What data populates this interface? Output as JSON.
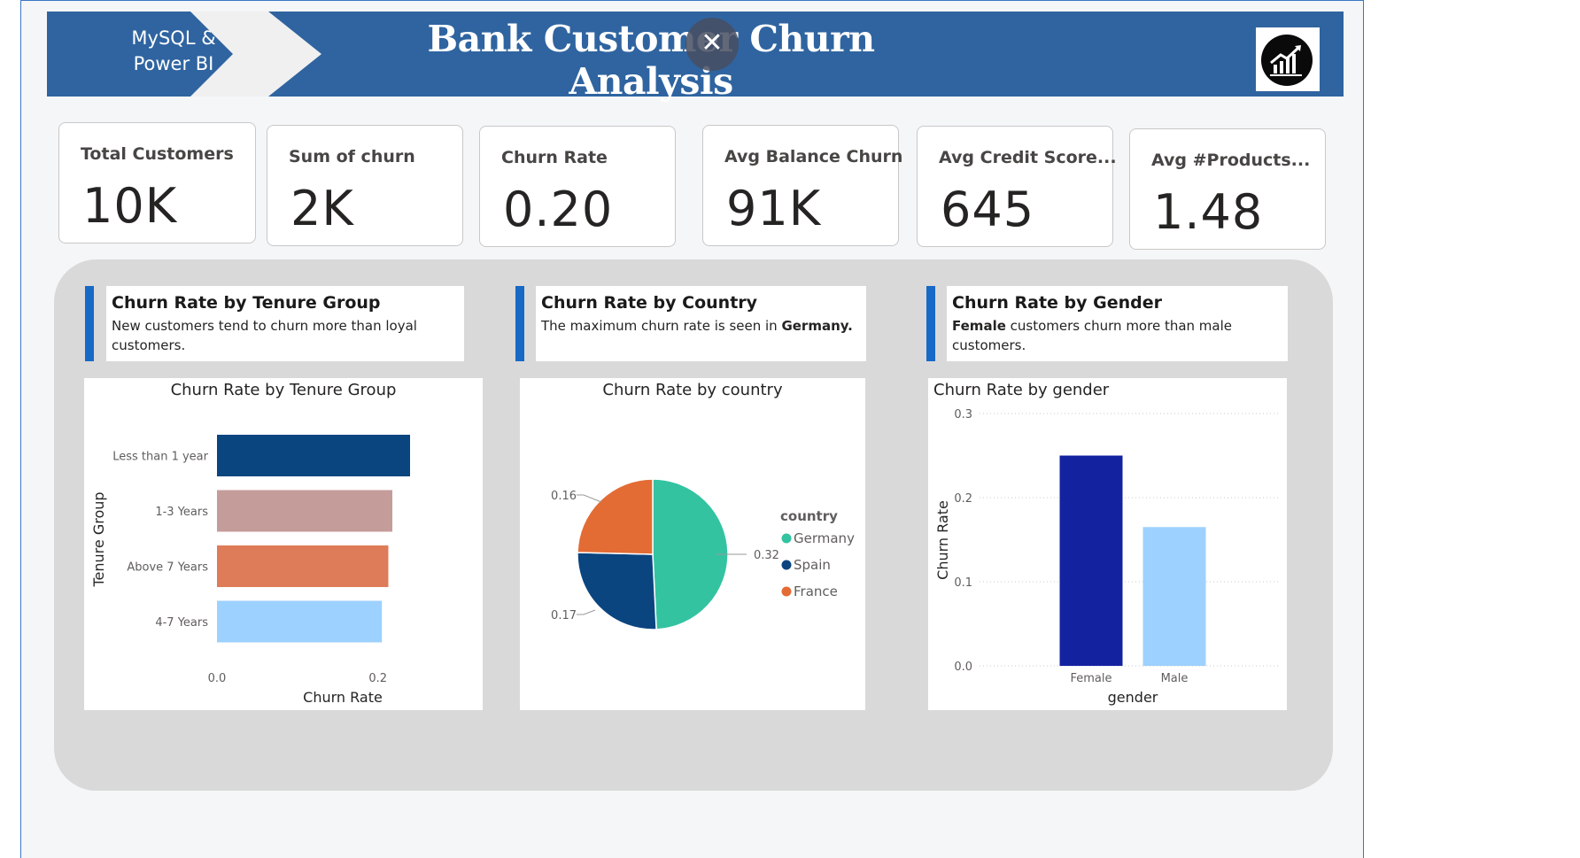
{
  "header": {
    "tag_line1": "MySQL &",
    "tag_line2": "Power BI",
    "title": "Bank Customer Churn Analysis",
    "close_symbol": "✕",
    "logo_icon": "growth-chart-icon"
  },
  "kpis": [
    {
      "label": "Total Customers",
      "value": "10K"
    },
    {
      "label": "Sum of churn",
      "value": "2K"
    },
    {
      "label": "Churn Rate",
      "value": "0.20"
    },
    {
      "label": "Avg Balance Churn",
      "value": "91K"
    },
    {
      "label": "Avg Credit Score...",
      "value": "645"
    },
    {
      "label": "Avg #Products...",
      "value": "1.48"
    }
  ],
  "cards": [
    {
      "title": "Churn Rate by Tenure Group",
      "subtitle": "New customers tend to churn more than loyal customers."
    },
    {
      "title": "Churn Rate by Country",
      "subtitle_pre": "The maximum churn rate is seen in ",
      "subtitle_bold": "Germany."
    },
    {
      "title": "Churn Rate by Gender",
      "subtitle_bold": "Female",
      "subtitle_post": " customers churn more than male customers."
    }
  ],
  "colors": {
    "banner": "#2f64a0",
    "accent": "#1769c6",
    "teal": "#33c3a1",
    "navy": "#0b4580",
    "orange": "#e36c35",
    "indigo": "#1323a0",
    "light_blue": "#9dd1ff"
  },
  "chart_data": [
    {
      "type": "bar",
      "orientation": "horizontal",
      "title": "Churn Rate by Tenure Group",
      "xlabel": "Churn Rate",
      "ylabel": "Tenure Group",
      "categories": [
        "Less than 1 year",
        "1-3 Years",
        "Above 7 Years",
        "4-7 Years"
      ],
      "values": [
        0.24,
        0.218,
        0.213,
        0.205
      ],
      "bar_colors": [
        "#0b4580",
        "#c49c99",
        "#de7b58",
        "#9dd1ff"
      ],
      "xlim": [
        0,
        0.24
      ],
      "xticks": [
        "0.0",
        "0.2"
      ]
    },
    {
      "type": "pie",
      "title": "Churn Rate by country",
      "legend_title": "country",
      "legend_position": "right",
      "slices": [
        {
          "label": "Germany",
          "value": 0.32,
          "color": "#33c3a1"
        },
        {
          "label": "Spain",
          "value": 0.17,
          "color": "#0b4580"
        },
        {
          "label": "France",
          "value": 0.16,
          "color": "#e36c35"
        }
      ],
      "data_labels": [
        "0.32",
        "0.17",
        "0.16"
      ]
    },
    {
      "type": "bar",
      "orientation": "vertical",
      "title": "Churn Rate by gender",
      "xlabel": "gender",
      "ylabel": "Churn Rate",
      "categories": [
        "Female",
        "Male"
      ],
      "values": [
        0.25,
        0.165
      ],
      "bar_colors": [
        "#1323a0",
        "#9dd1ff"
      ],
      "ylim": [
        0,
        0.3
      ],
      "yticks": [
        "0.0",
        "0.1",
        "0.2",
        "0.3"
      ],
      "grid": true
    }
  ]
}
